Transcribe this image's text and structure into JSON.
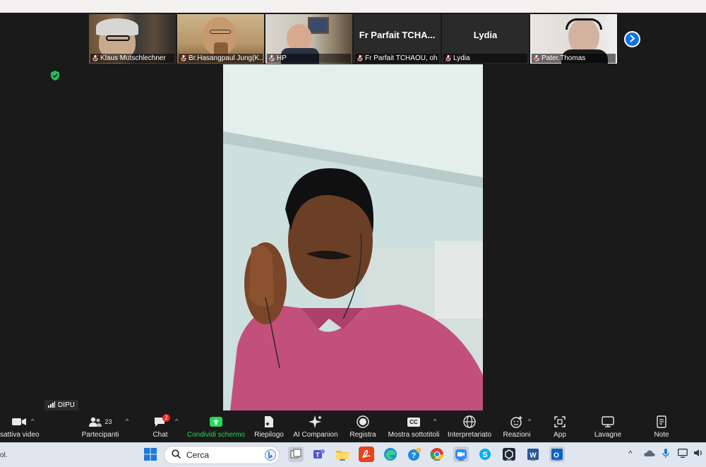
{
  "participants_strip": [
    {
      "name": "Klaus Mutschlechner",
      "type": "video"
    },
    {
      "name": "Br.Hasangpaul Jung(K...",
      "type": "video"
    },
    {
      "name": "HP",
      "type": "video"
    },
    {
      "name": "Fr Parfait TCHAOU, oh",
      "display": "Fr Parfait TCHA...",
      "type": "name"
    },
    {
      "name": "Lydia",
      "display": "Lydia",
      "type": "name"
    },
    {
      "name": "Pater.Thomas",
      "type": "video"
    }
  ],
  "active_speaker": "DIPU",
  "toolbar": {
    "video": "sattiva video",
    "participants": "Partecipanti",
    "participants_count": "23",
    "chat": "Chat",
    "chat_badge": "2",
    "share": "Condividi schermo",
    "summary": "Riepilogo",
    "ai": "AI Companion",
    "record": "Registra",
    "captions": "Mostra sottotitoli",
    "captions_icon": "CC",
    "interpretation": "Interpretariato",
    "reactions": "Reazioni",
    "apps": "App",
    "whiteboards": "Lavagne",
    "notes": "Note"
  },
  "taskbar": {
    "search_placeholder": "Cerca",
    "left_fragment": "ol."
  },
  "colors": {
    "share_green": "#23d959",
    "accent_blue": "#0e72ed",
    "badge_red": "#e02828"
  }
}
